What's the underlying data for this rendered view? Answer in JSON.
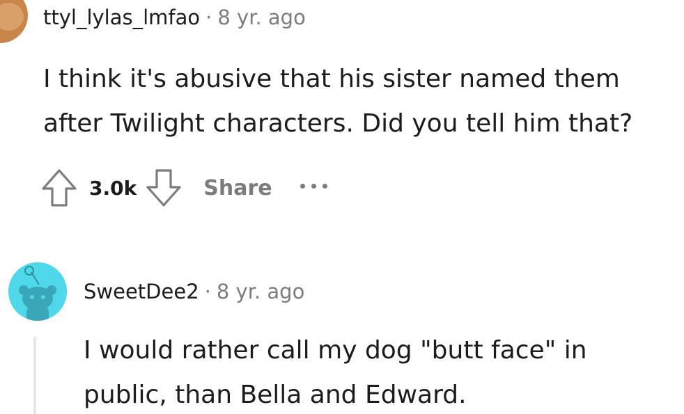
{
  "comments": [
    {
      "username": "ttyl_lylas_lmfao",
      "separator": "·",
      "timestamp": "8 yr. ago",
      "body": "I think it's abusive that his sister named them after Twilight characters. Did you tell him that?",
      "score": "3.0k",
      "share_label": "Share",
      "avatar_color": "#c8864a"
    },
    {
      "username": "SweetDee2",
      "separator": "·",
      "timestamp": "8 yr. ago",
      "body": "I would rather call my dog \"butt face\" in public, than Bella and Edward.",
      "avatar_color": "#4fd8ea"
    }
  ],
  "icons": {
    "upvote": "arrow-up-outline-icon",
    "downvote": "arrow-down-outline-icon",
    "more": "horizontal-ellipsis-icon"
  },
  "colors": {
    "text": "#1c1c1c",
    "muted": "#7c7c7c",
    "thread_line": "#e6e6e6"
  }
}
